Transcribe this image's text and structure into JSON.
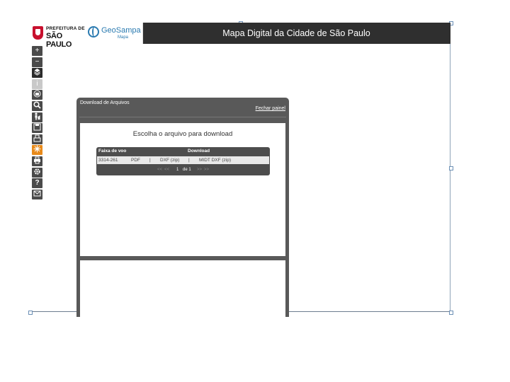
{
  "header": {
    "prefeitura_line1": "PREFEITURA DE",
    "prefeitura_line2": "SÃO PAULO",
    "geosampa_name": "GeoSampa",
    "geosampa_sub": "Mapa",
    "title": "Mapa Digital da Cidade de São Paulo"
  },
  "toolbar": {
    "buttons": [
      {
        "name": "zoom-in",
        "glyph": "+"
      },
      {
        "name": "zoom-out",
        "glyph": "−"
      },
      {
        "name": "layers",
        "glyph": "layers-icon"
      },
      {
        "name": "info",
        "glyph": "i"
      },
      {
        "name": "identify",
        "glyph": "identify-icon"
      },
      {
        "name": "search",
        "glyph": "search-icon"
      },
      {
        "name": "street-view",
        "glyph": "person-icon"
      },
      {
        "name": "save",
        "glyph": "save-icon"
      },
      {
        "name": "download",
        "glyph": "download-icon"
      },
      {
        "name": "network",
        "glyph": "network-icon"
      },
      {
        "name": "print",
        "glyph": "print-icon"
      },
      {
        "name": "settings",
        "glyph": "gear-icon"
      },
      {
        "name": "help",
        "glyph": "?"
      },
      {
        "name": "contact",
        "glyph": "mail-icon"
      }
    ],
    "plus": "+",
    "minus": "−",
    "info": "i",
    "help": "?"
  },
  "panel": {
    "title": "Download de Arquivos",
    "close_label": "Fechar painel",
    "heading": "Escolha o arquivo para download",
    "table": {
      "col1": "Faixa de voo",
      "col2": "Download",
      "row": {
        "faixa": "3314-261",
        "pdf": "PDF",
        "sep1": "|",
        "dxf": "DXF (zip)",
        "sep2": "|",
        "midt": "MIDT DXF (zip)"
      },
      "pager": {
        "first": "<<",
        "prev": "<<",
        "current": "1",
        "of": "de 1",
        "next": ">>",
        "last": ">>"
      }
    }
  },
  "colors": {
    "topbar": "#2f2f2f",
    "panel": "#595959",
    "accent_orange": "#e88a1a",
    "geosampa_blue": "#2a7ab0",
    "prefeitura_red": "#c8102e"
  }
}
